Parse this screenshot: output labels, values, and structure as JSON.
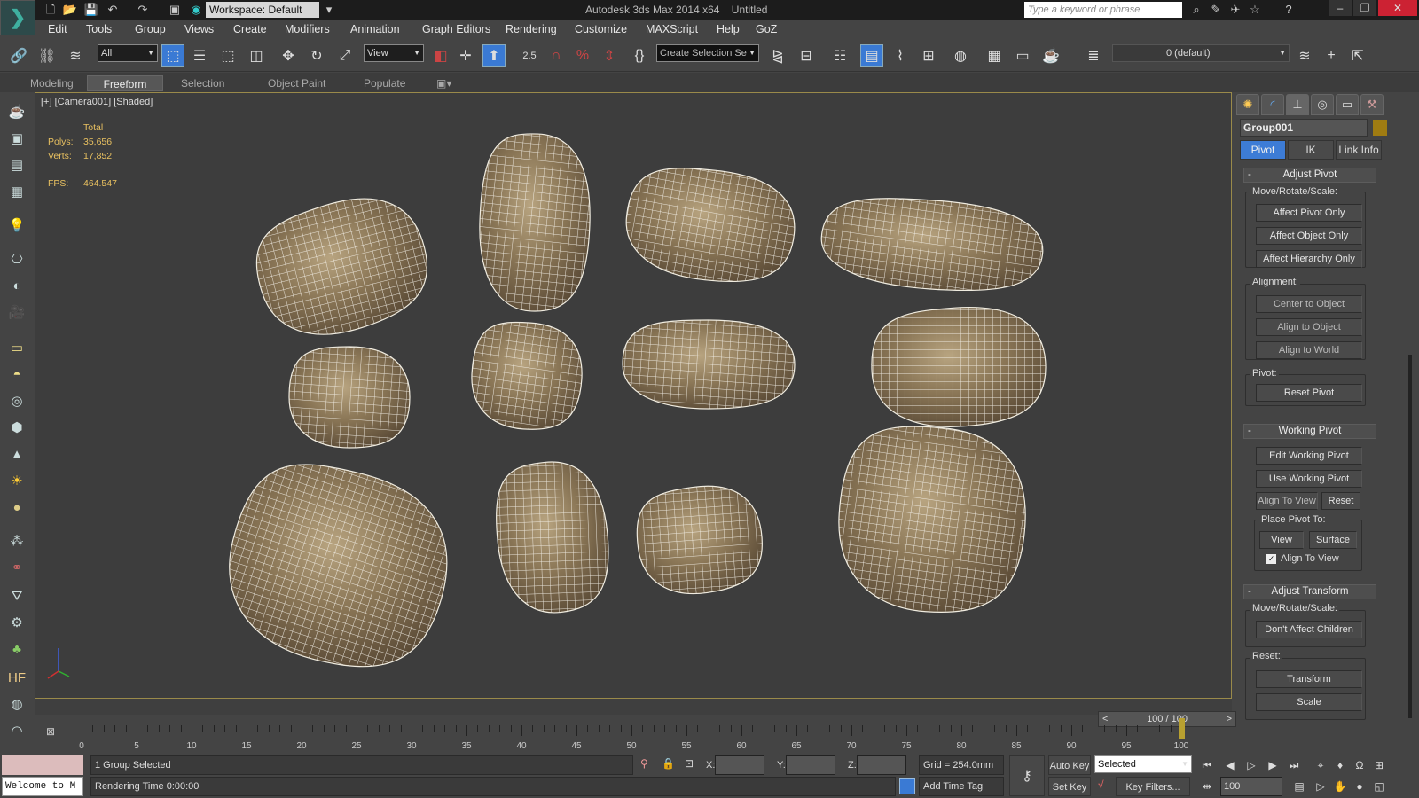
{
  "titlebar": {
    "workspace": "Workspace: Default",
    "app_title": "Autodesk 3ds Max  2014 x64",
    "doc_title": "Untitled",
    "search_placeholder": "Type a keyword or phrase"
  },
  "menu": [
    "Edit",
    "Tools",
    "Group",
    "Views",
    "Create",
    "Modifiers",
    "Animation",
    "Graph Editors",
    "Rendering",
    "Customize",
    "MAXScript",
    "Help",
    "GoZ"
  ],
  "toolbar": {
    "selection_filter": "All",
    "reference_coord": "View",
    "snap_value": "2.5",
    "named_selection": "Create Selection Se",
    "layer": "0 (default)"
  },
  "ribbon_tabs": [
    "Modeling",
    "Freeform",
    "Selection",
    "Object Paint",
    "Populate"
  ],
  "viewport": {
    "label": "[+] [Camera001] [Shaded]",
    "stats": {
      "total_label": "Total",
      "polys_label": "Polys:",
      "polys": "35,656",
      "verts_label": "Verts:",
      "verts": "17,852",
      "fps_label": "FPS:",
      "fps": "464.547"
    }
  },
  "command_panel": {
    "object_name": "Group001",
    "object_color": "#a07c12",
    "tabs": [
      "Pivot",
      "IK",
      "Link Info"
    ],
    "adjust_pivot": {
      "title": "Adjust Pivot",
      "move_label": "Move/Rotate/Scale:",
      "move_buttons": [
        "Affect Pivot Only",
        "Affect Object Only",
        "Affect Hierarchy Only"
      ],
      "alignment_label": "Alignment:",
      "alignment_buttons": [
        "Center to Object",
        "Align to Object",
        "Align to World"
      ],
      "pivot_label": "Pivot:",
      "reset_pivot": "Reset Pivot"
    },
    "working_pivot": {
      "title": "Working Pivot",
      "edit": "Edit Working Pivot",
      "use": "Use Working Pivot",
      "align_to_view": "Align To View",
      "reset": "Reset",
      "place_label": "Place Pivot To:",
      "view": "View",
      "surface": "Surface",
      "align_checkbox": "Align To View",
      "align_checked": true
    },
    "adjust_transform": {
      "title": "Adjust Transform",
      "move_label": "Move/Rotate/Scale:",
      "dont_affect": "Don't Affect Children",
      "reset_label": "Reset:",
      "transform": "Transform",
      "scale": "Scale"
    },
    "collapse_symbol": "-"
  },
  "timeline": {
    "frame_display": "100 / 100",
    "prev": "<",
    "next": ">",
    "current_frame": 100,
    "max_frame": 100,
    "labels": [
      "0",
      "5",
      "10",
      "15",
      "20",
      "25",
      "30",
      "35",
      "40",
      "45",
      "50",
      "55",
      "60",
      "65",
      "70",
      "75",
      "80",
      "85",
      "90",
      "95",
      "100"
    ]
  },
  "status": {
    "maxscript_listener": "Welcome to M",
    "selection": "1 Group Selected",
    "render_time": "Rendering Time  0:00:00",
    "x_label": "X:",
    "y_label": "Y:",
    "z_label": "Z:",
    "grid": "Grid = 254.0mm",
    "add_time_tag": "Add Time Tag",
    "auto_key": "Auto Key",
    "set_key": "Set Key",
    "key_mode": "Selected",
    "key_filters": "Key Filters...",
    "frame_field": "100"
  }
}
